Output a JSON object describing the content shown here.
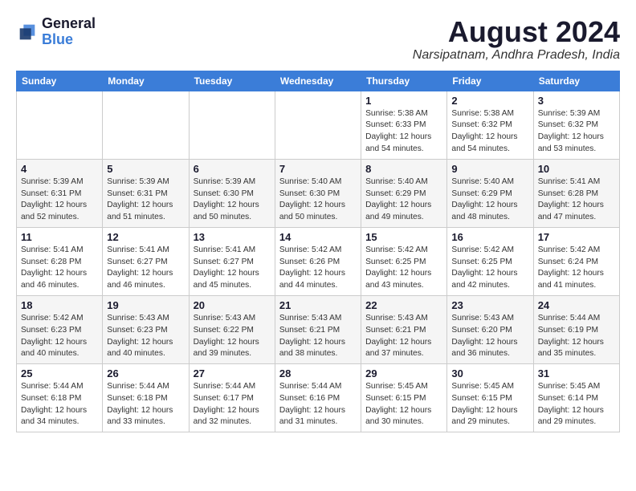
{
  "header": {
    "logo_line1": "General",
    "logo_line2": "Blue",
    "month_year": "August 2024",
    "location": "Narsipatnam, Andhra Pradesh, India"
  },
  "weekdays": [
    "Sunday",
    "Monday",
    "Tuesday",
    "Wednesday",
    "Thursday",
    "Friday",
    "Saturday"
  ],
  "weeks": [
    [
      {
        "day": "",
        "info": ""
      },
      {
        "day": "",
        "info": ""
      },
      {
        "day": "",
        "info": ""
      },
      {
        "day": "",
        "info": ""
      },
      {
        "day": "1",
        "info": "Sunrise: 5:38 AM\nSunset: 6:33 PM\nDaylight: 12 hours\nand 54 minutes."
      },
      {
        "day": "2",
        "info": "Sunrise: 5:38 AM\nSunset: 6:32 PM\nDaylight: 12 hours\nand 54 minutes."
      },
      {
        "day": "3",
        "info": "Sunrise: 5:39 AM\nSunset: 6:32 PM\nDaylight: 12 hours\nand 53 minutes."
      }
    ],
    [
      {
        "day": "4",
        "info": "Sunrise: 5:39 AM\nSunset: 6:31 PM\nDaylight: 12 hours\nand 52 minutes."
      },
      {
        "day": "5",
        "info": "Sunrise: 5:39 AM\nSunset: 6:31 PM\nDaylight: 12 hours\nand 51 minutes."
      },
      {
        "day": "6",
        "info": "Sunrise: 5:39 AM\nSunset: 6:30 PM\nDaylight: 12 hours\nand 50 minutes."
      },
      {
        "day": "7",
        "info": "Sunrise: 5:40 AM\nSunset: 6:30 PM\nDaylight: 12 hours\nand 50 minutes."
      },
      {
        "day": "8",
        "info": "Sunrise: 5:40 AM\nSunset: 6:29 PM\nDaylight: 12 hours\nand 49 minutes."
      },
      {
        "day": "9",
        "info": "Sunrise: 5:40 AM\nSunset: 6:29 PM\nDaylight: 12 hours\nand 48 minutes."
      },
      {
        "day": "10",
        "info": "Sunrise: 5:41 AM\nSunset: 6:28 PM\nDaylight: 12 hours\nand 47 minutes."
      }
    ],
    [
      {
        "day": "11",
        "info": "Sunrise: 5:41 AM\nSunset: 6:28 PM\nDaylight: 12 hours\nand 46 minutes."
      },
      {
        "day": "12",
        "info": "Sunrise: 5:41 AM\nSunset: 6:27 PM\nDaylight: 12 hours\nand 46 minutes."
      },
      {
        "day": "13",
        "info": "Sunrise: 5:41 AM\nSunset: 6:27 PM\nDaylight: 12 hours\nand 45 minutes."
      },
      {
        "day": "14",
        "info": "Sunrise: 5:42 AM\nSunset: 6:26 PM\nDaylight: 12 hours\nand 44 minutes."
      },
      {
        "day": "15",
        "info": "Sunrise: 5:42 AM\nSunset: 6:25 PM\nDaylight: 12 hours\nand 43 minutes."
      },
      {
        "day": "16",
        "info": "Sunrise: 5:42 AM\nSunset: 6:25 PM\nDaylight: 12 hours\nand 42 minutes."
      },
      {
        "day": "17",
        "info": "Sunrise: 5:42 AM\nSunset: 6:24 PM\nDaylight: 12 hours\nand 41 minutes."
      }
    ],
    [
      {
        "day": "18",
        "info": "Sunrise: 5:42 AM\nSunset: 6:23 PM\nDaylight: 12 hours\nand 40 minutes."
      },
      {
        "day": "19",
        "info": "Sunrise: 5:43 AM\nSunset: 6:23 PM\nDaylight: 12 hours\nand 40 minutes."
      },
      {
        "day": "20",
        "info": "Sunrise: 5:43 AM\nSunset: 6:22 PM\nDaylight: 12 hours\nand 39 minutes."
      },
      {
        "day": "21",
        "info": "Sunrise: 5:43 AM\nSunset: 6:21 PM\nDaylight: 12 hours\nand 38 minutes."
      },
      {
        "day": "22",
        "info": "Sunrise: 5:43 AM\nSunset: 6:21 PM\nDaylight: 12 hours\nand 37 minutes."
      },
      {
        "day": "23",
        "info": "Sunrise: 5:43 AM\nSunset: 6:20 PM\nDaylight: 12 hours\nand 36 minutes."
      },
      {
        "day": "24",
        "info": "Sunrise: 5:44 AM\nSunset: 6:19 PM\nDaylight: 12 hours\nand 35 minutes."
      }
    ],
    [
      {
        "day": "25",
        "info": "Sunrise: 5:44 AM\nSunset: 6:18 PM\nDaylight: 12 hours\nand 34 minutes."
      },
      {
        "day": "26",
        "info": "Sunrise: 5:44 AM\nSunset: 6:18 PM\nDaylight: 12 hours\nand 33 minutes."
      },
      {
        "day": "27",
        "info": "Sunrise: 5:44 AM\nSunset: 6:17 PM\nDaylight: 12 hours\nand 32 minutes."
      },
      {
        "day": "28",
        "info": "Sunrise: 5:44 AM\nSunset: 6:16 PM\nDaylight: 12 hours\nand 31 minutes."
      },
      {
        "day": "29",
        "info": "Sunrise: 5:45 AM\nSunset: 6:15 PM\nDaylight: 12 hours\nand 30 minutes."
      },
      {
        "day": "30",
        "info": "Sunrise: 5:45 AM\nSunset: 6:15 PM\nDaylight: 12 hours\nand 29 minutes."
      },
      {
        "day": "31",
        "info": "Sunrise: 5:45 AM\nSunset: 6:14 PM\nDaylight: 12 hours\nand 29 minutes."
      }
    ]
  ]
}
